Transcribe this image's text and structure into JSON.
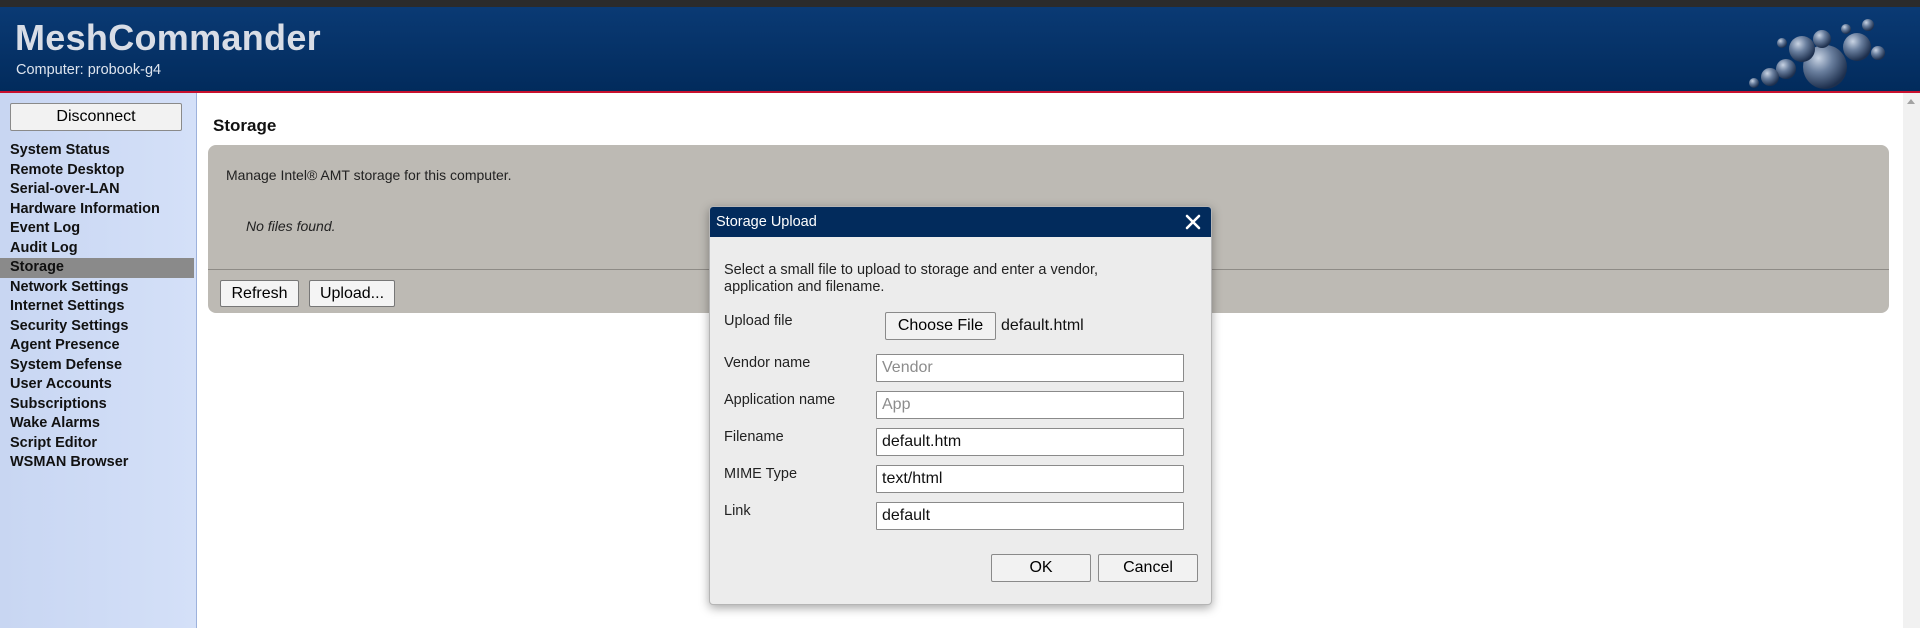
{
  "header": {
    "app_title": "MeshCommander",
    "computer_label": "Computer: probook-g4"
  },
  "sidebar": {
    "disconnect_label": "Disconnect",
    "active_item": "Storage",
    "items": [
      {
        "label": "System Status"
      },
      {
        "label": "Remote Desktop"
      },
      {
        "label": "Serial-over-LAN"
      },
      {
        "label": "Hardware Information"
      },
      {
        "label": "Event Log"
      },
      {
        "label": "Audit Log"
      },
      {
        "label": "Storage"
      },
      {
        "label": "Network Settings"
      },
      {
        "label": "Internet Settings"
      },
      {
        "label": "Security Settings"
      },
      {
        "label": "Agent Presence"
      },
      {
        "label": "System Defense"
      },
      {
        "label": "User Accounts"
      },
      {
        "label": "Subscriptions"
      },
      {
        "label": "Wake Alarms"
      },
      {
        "label": "Script Editor"
      },
      {
        "label": "WSMAN Browser"
      }
    ]
  },
  "main": {
    "title": "Storage",
    "description": "Manage Intel® AMT storage for this computer.",
    "empty_message": "No files found.",
    "refresh_label": "Refresh",
    "upload_label": "Upload..."
  },
  "dialog": {
    "title": "Storage Upload",
    "intro": "Select a small file to upload to storage and enter a vendor, application and filename.",
    "upload_file_label": "Upload file",
    "choose_file_label": "Choose File",
    "chosen_file": "default.html",
    "vendor_label": "Vendor name",
    "vendor_value": "",
    "vendor_placeholder": "Vendor",
    "application_label": "Application name",
    "application_value": "",
    "application_placeholder": "App",
    "filename_label": "Filename",
    "filename_value": "default.htm",
    "mime_label": "MIME Type",
    "mime_value": "text/html",
    "link_label": "Link",
    "link_value": "default",
    "ok_label": "OK",
    "cancel_label": "Cancel"
  },
  "colors": {
    "header_bg": "#022b5c",
    "header_accent": "#c8102e",
    "sidebar_bg": "#d0dcf5",
    "active_item_bg": "#8a8a8a",
    "panel_bg": "#bdbab4"
  },
  "icons": {
    "close": "close-icon",
    "logo_decoration": "bubbles-logo-icon"
  }
}
